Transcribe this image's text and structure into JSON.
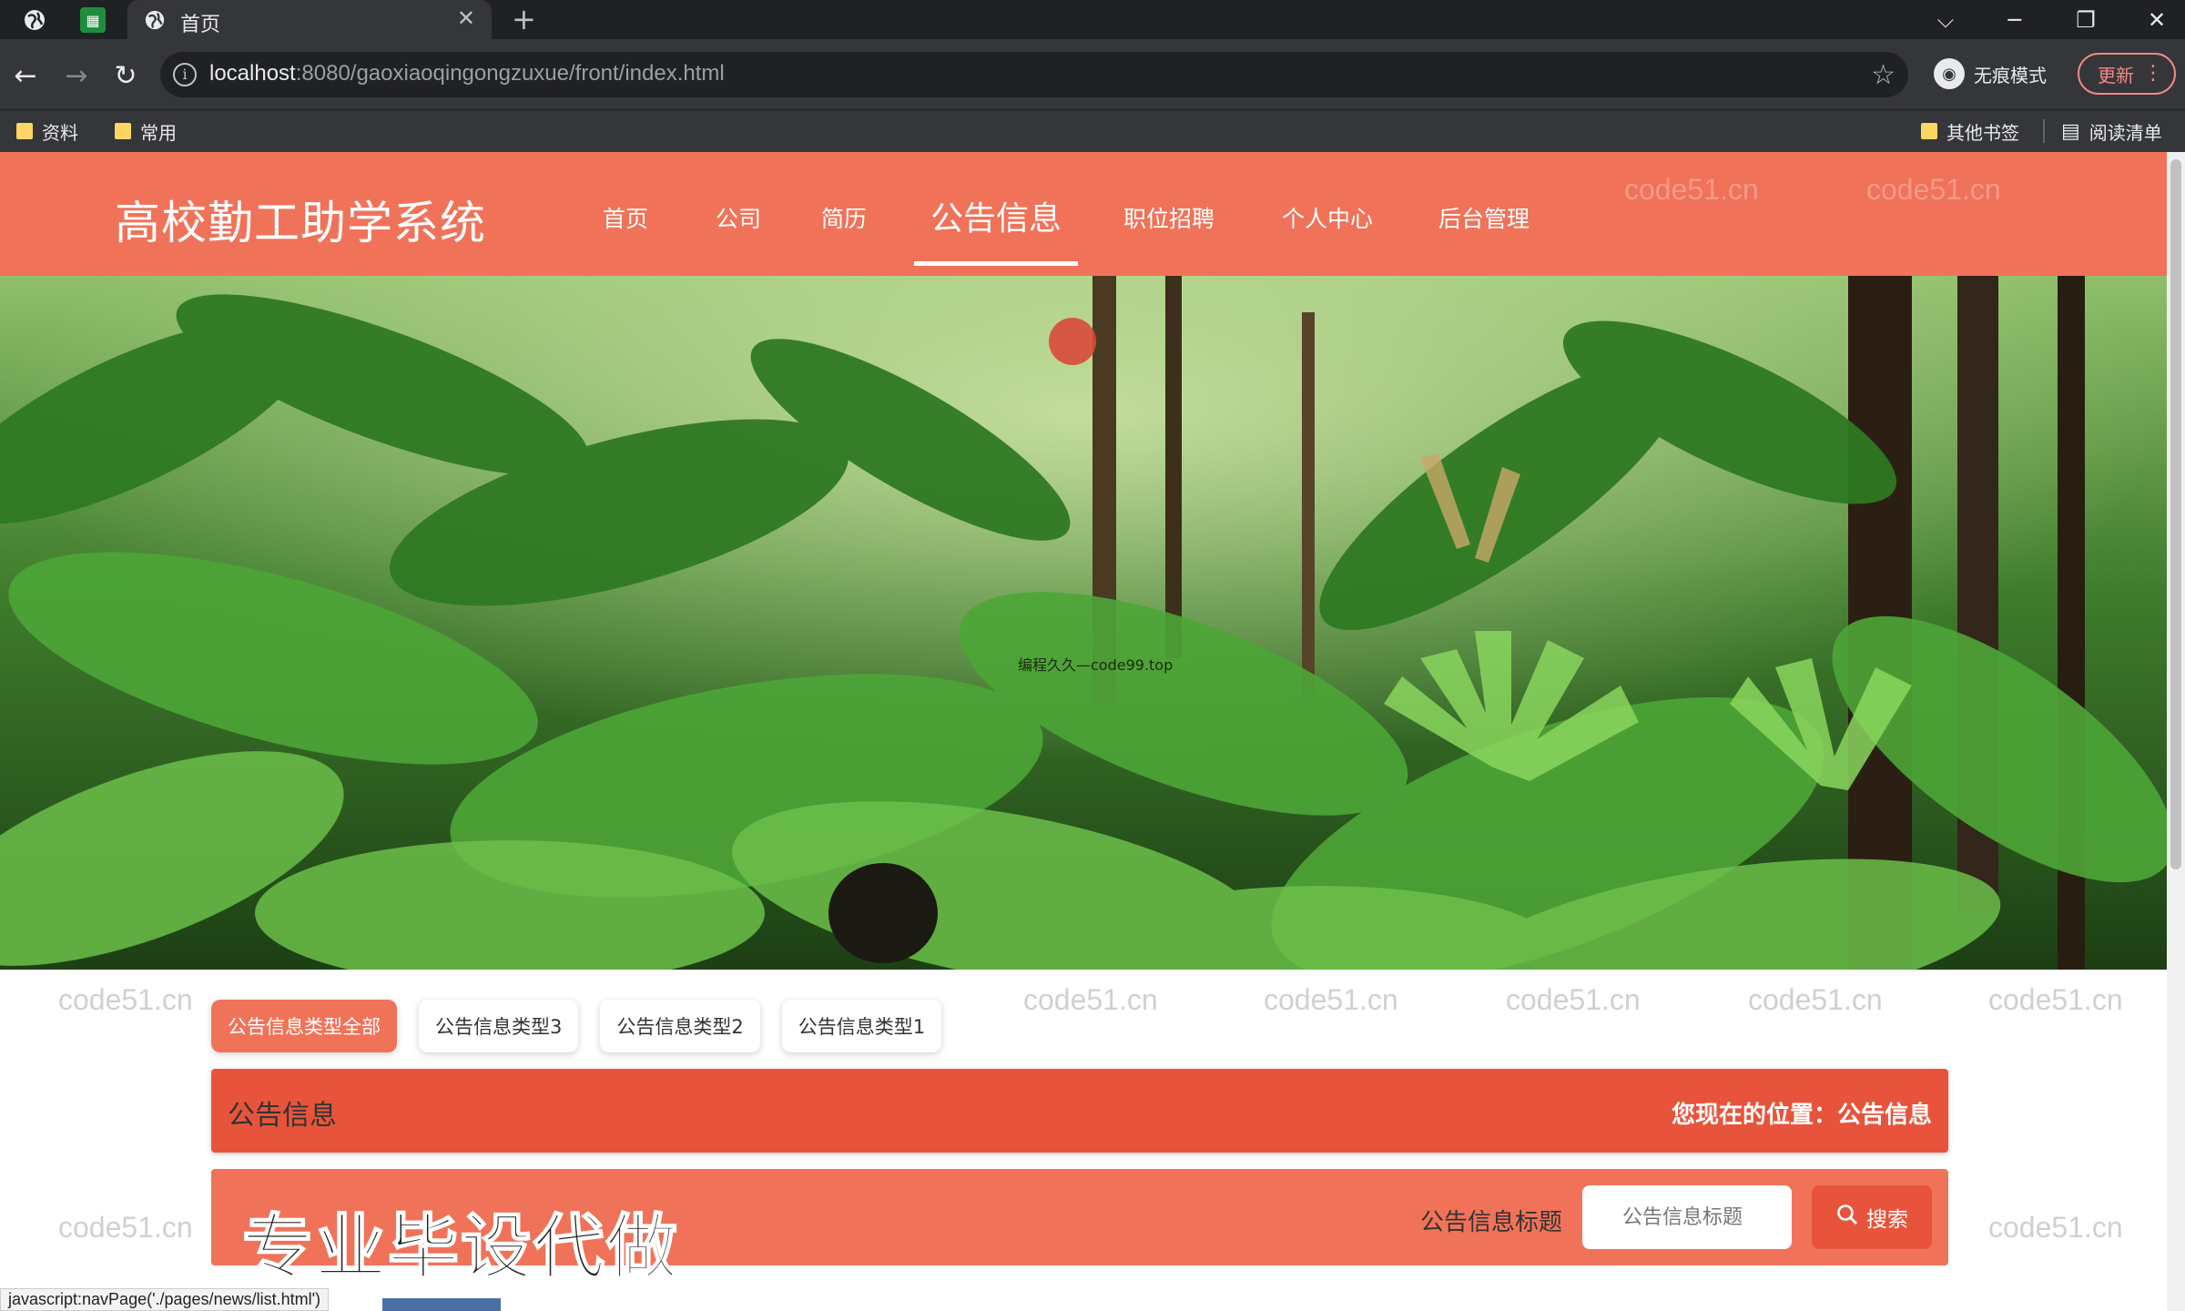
{
  "browser": {
    "tab_title": "首页",
    "address": {
      "host": "localhost",
      "path": ":8080/gaoxiaoqingongzuxue/front/index.html"
    },
    "incognito_label": "无痕模式",
    "update_label": "更新",
    "bookmarks": [
      "资料",
      "常用"
    ],
    "other_bookmarks": "其他书签",
    "reading_list": "阅读清单"
  },
  "site": {
    "title": "高校勤工助学系统",
    "nav": [
      "首页",
      "公司",
      "简历",
      "公告信息",
      "职位招聘",
      "个人中心",
      "后台管理"
    ],
    "active_nav": "公告信息",
    "carousel": {
      "slides": 3,
      "active_index": 0
    },
    "hero_caption": "编程久久—code99.top"
  },
  "categories": [
    "公告信息类型全部",
    "公告信息类型3",
    "公告信息类型2",
    "公告信息类型1"
  ],
  "section": {
    "title": "公告信息",
    "location_label": "您现在的位置：",
    "location_value": "公告信息"
  },
  "search": {
    "label": "公告信息标题",
    "placeholder": "公告信息标题",
    "button": "搜索"
  },
  "promo_text": "专业毕设代做",
  "watermark": "code51.cn",
  "status_bar": "javascript:navPage('./pages/news/list.html')",
  "colors": {
    "primary": "#f07359",
    "primary_dark": "#e8543b",
    "active_dot": "#f07359"
  }
}
